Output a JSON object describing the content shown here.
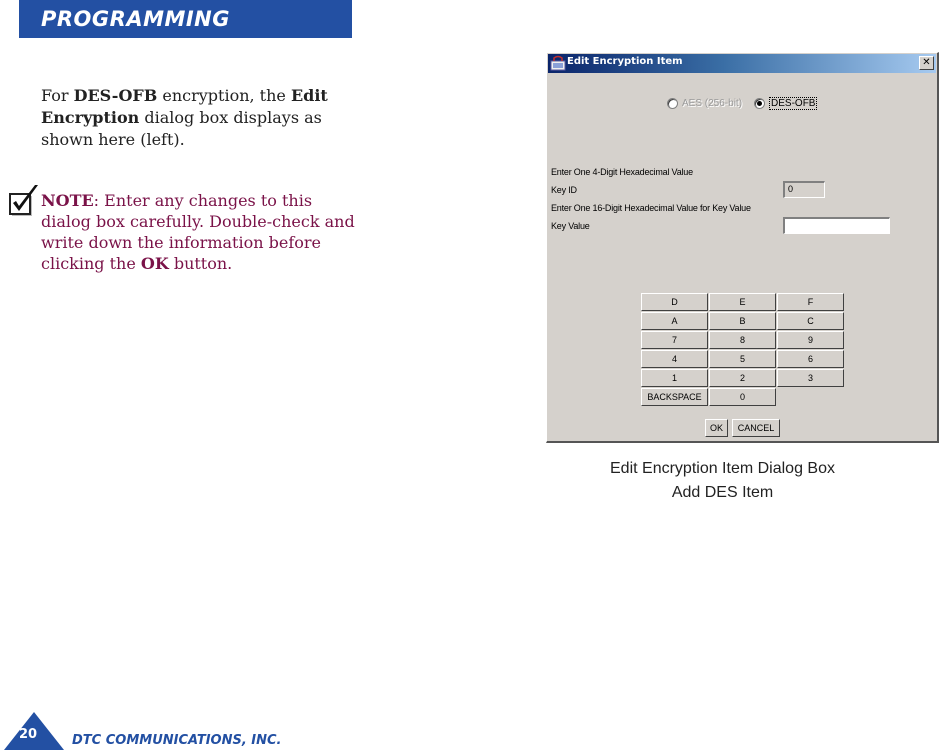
{
  "header": {
    "title": "PROGRAMMING"
  },
  "intro": {
    "p1": "For ",
    "b1": "DES-OFB",
    "p2": " encryption, the ",
    "b2": "Edit Encryption",
    "p3": " dialog box displays as shown here (left)."
  },
  "note": {
    "label": "NOTE",
    "text": ": Enter any changes to this dialog box carefully. Double-check and write down the information before clicking the ",
    "ok": "OK",
    "end": " button."
  },
  "dialog": {
    "title": "Edit Encryption Item",
    "close_symbol": "✕",
    "radios": [
      {
        "label": "AES (256-bit)",
        "checked": false,
        "enabled": false
      },
      {
        "label": "DES-OFB",
        "checked": true,
        "enabled": true
      }
    ],
    "fields": {
      "key_id_instruction": "Enter One 4-Digit Hexadecimal Value",
      "key_id_label": "Key ID",
      "key_id_value": "0",
      "key_value_instruction": "Enter One 16-Digit Hexadecimal Value for Key Value",
      "key_value_label": "Key Value",
      "key_value_value": ""
    },
    "keypad": [
      [
        "D",
        "E",
        "F"
      ],
      [
        "A",
        "B",
        "C"
      ],
      [
        "7",
        "8",
        "9"
      ],
      [
        "4",
        "5",
        "6"
      ],
      [
        "1",
        "2",
        "3"
      ],
      [
        "BACKSPACE",
        "0"
      ]
    ],
    "buttons": {
      "ok": "OK",
      "cancel": "CANCEL"
    }
  },
  "caption": {
    "line1": "Edit Encryption Item Dialog Box",
    "line2": "Add DES Item"
  },
  "footer": {
    "page_number": "20",
    "company": "DTC COMMUNICATIONS, INC."
  },
  "colors": {
    "brand_blue": "#2350a3",
    "note_maroon": "#7a1248",
    "dialog_gray": "#d5d1cc"
  }
}
